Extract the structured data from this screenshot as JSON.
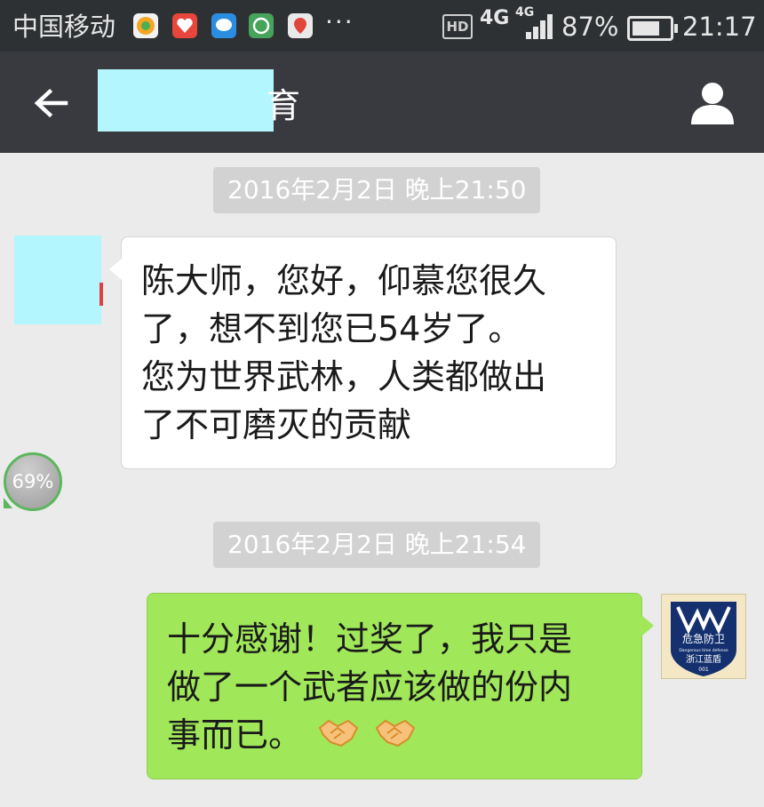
{
  "status_bar": {
    "carrier": "中国移动",
    "more": "···",
    "hd_label": "HD",
    "network": "4G",
    "network_small": "4G",
    "battery_percent": "87%",
    "battery_level": 0.87,
    "clock": "21:17"
  },
  "header": {
    "title_suffix": "育"
  },
  "messages": [
    {
      "timestamp": "2016年2月2日 晚上21:50",
      "direction": "incoming",
      "lines": [
        "陈大师，您好，仰慕您很久",
        "了，想不到您已54岁了。",
        "您为世界武林，人类都做出",
        "了不可磨灭的贡献"
      ]
    },
    {
      "timestamp": "2016年2月2日 晚上21:54",
      "direction": "outgoing",
      "lines": [
        "十分感谢！过奖了，我只是",
        "做了一个武者应该做的份内",
        "事而已。"
      ],
      "emojis": [
        "handshake-emoji",
        "handshake-emoji"
      ]
    }
  ],
  "avatar_right": {
    "text_top": "危急防卫",
    "text_sub": "Dangerous time defense",
    "text_bottom": "浙江蓝盾",
    "number": "001"
  },
  "floating_badge": "69%",
  "colors": {
    "status_bar": "#2e3133",
    "title_bar": "#393a3f",
    "chat_background": "#ebebeb",
    "outgoing_bubble": "#a0e75a",
    "incoming_bubble": "#ffffff",
    "redaction": "#b3f6fd"
  }
}
